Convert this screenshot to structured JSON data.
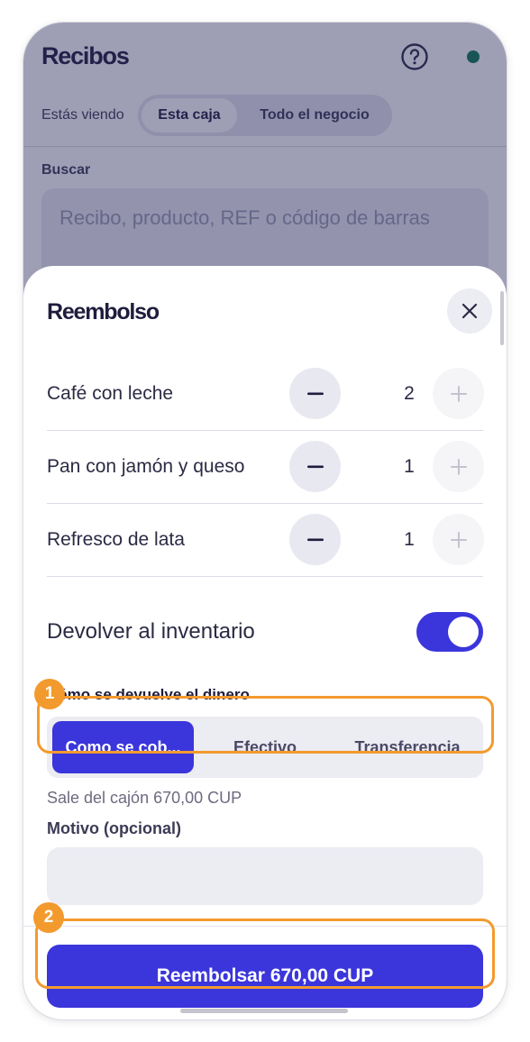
{
  "colors": {
    "accent": "#3b35dc",
    "highlight": "#f39a2e",
    "status_online": "#0d7a55"
  },
  "header": {
    "title": "Recibos",
    "help_icon": "question-circle-icon",
    "status_icon": "online-dot-icon",
    "viewing_label": "Estás viendo",
    "scope_options": [
      "Esta caja",
      "Todo el negocio"
    ],
    "scope_selected": "Esta caja"
  },
  "search": {
    "label": "Buscar",
    "placeholder": "Recibo, producto, REF o código de barras"
  },
  "refund_sheet": {
    "title": "Reembolso",
    "close_icon": "close-icon",
    "items": [
      {
        "name": "Café con leche",
        "quantity": "2",
        "minus": "−",
        "plus": "+"
      },
      {
        "name": "Pan con jamón y queso",
        "quantity": "1",
        "minus": "−",
        "plus": "+"
      },
      {
        "name": "Refresco de lata",
        "quantity": "1",
        "minus": "−",
        "plus": "+"
      }
    ],
    "return_to_inventory": {
      "label": "Devolver al inventario",
      "on": true
    },
    "method": {
      "label": "Cómo se devuelve el dinero",
      "options": [
        "Como se cob...",
        "Efectivo",
        "Transferencia"
      ],
      "selected": "Como se cob..."
    },
    "cash_info": "Sale del cajón 670,00 CUP",
    "reason": {
      "label": "Motivo (opcional)",
      "value": "",
      "placeholder": ""
    },
    "refund_button": "Reembolsar 670,00 CUP"
  },
  "annotations": [
    "1",
    "2"
  ]
}
